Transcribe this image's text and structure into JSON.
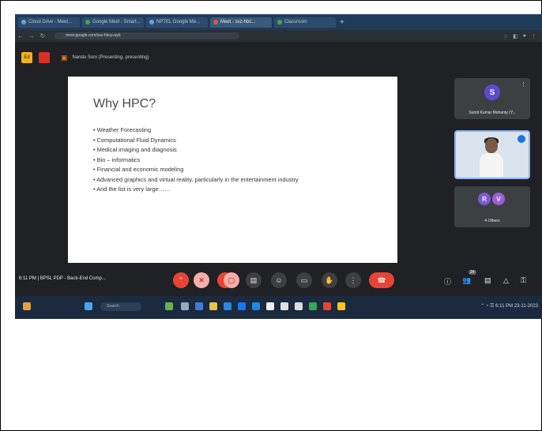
{
  "browser": {
    "tabs": [
      {
        "label": "Cloud Drive - Meet..."
      },
      {
        "label": "Google Meet - Smart..."
      },
      {
        "label": "NPTEL Google Me..."
      },
      {
        "label": "Meet - ssz-hbc..."
      },
      {
        "label": "Classroom"
      }
    ],
    "new_tab": "+",
    "url": "meet.google.com/ssz-hbcp-ayb"
  },
  "meeting": {
    "presenting_text": "Nandu Soni (Presenting, presenting)",
    "badge_label": "Ed"
  },
  "slide": {
    "title": "Why HPC?",
    "bullets": [
      "Weather Forecasting",
      "Computational Fluid Dynamics",
      "Medical imaging and diagnosis",
      "Bio – informatics",
      "Financial and economic modeling",
      "Advanced graphics and virtual reality, particularly in the entertainment industry",
      "And the list is very large……"
    ]
  },
  "participants": [
    {
      "initial": "S",
      "name": "Sumit Kumar Mohanty (Y...",
      "color": "#5b4bd1"
    },
    {
      "name": "",
      "color": "#1a73e8"
    },
    {
      "initials": [
        "R",
        "V"
      ],
      "name": "4 Others",
      "colors": [
        "#7b5ad6",
        "#9b5fd8"
      ]
    }
  ],
  "controls": {
    "meeting_info": "6:11 PM | BPSL PDP - Back-End Comp...",
    "participant_count": "24"
  },
  "taskbar": {
    "search_label": "Search",
    "tray_time": "6:11 PM",
    "tray_date": "23-11-2023"
  }
}
